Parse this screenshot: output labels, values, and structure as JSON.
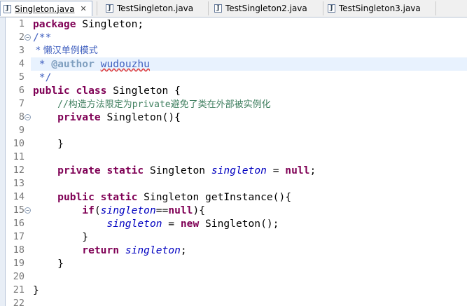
{
  "tabs": [
    {
      "label": "Singleton.java",
      "active": true,
      "close": "✕"
    },
    {
      "label": "TestSingleton.java",
      "active": false
    },
    {
      "label": "TestSingleton2.java",
      "active": false
    },
    {
      "label": "TestSingleton3.java",
      "active": false
    }
  ],
  "editor": {
    "line_numbers": [
      "1",
      "2",
      "3",
      "4",
      "5",
      "6",
      "7",
      "8",
      "9",
      "10",
      "11",
      "12",
      "13",
      "14",
      "15",
      "16",
      "17",
      "18",
      "19",
      "20",
      "21",
      "22"
    ],
    "code": {
      "l1_kw": "package",
      "l1_rest": " Singleton;",
      "l2": "/**",
      "l3": " * 懒汉单例模式",
      "l4_star": " * ",
      "l4_tag": "@author",
      "l4_sp": " ",
      "l4_name": "wudouzhu",
      "l5": " */",
      "l6_kw1": "public",
      "l6_sp": " ",
      "l6_kw2": "class",
      "l6_rest": " Singleton {",
      "l7_indent": "    ",
      "l7_comment": "//构造方法限定为private避免了类在外部被实例化",
      "l8_indent": "    ",
      "l8_kw": "private",
      "l8_rest": " Singleton(){",
      "l10": "    }",
      "l12_indent": "    ",
      "l12_kw1": "private",
      "l12_sp": " ",
      "l12_kw2": "static",
      "l12_mid": " Singleton ",
      "l12_field": "singleton",
      "l12_eq": " = ",
      "l12_null": "null",
      "l12_end": ";",
      "l14_indent": "    ",
      "l14_kw1": "public",
      "l14_sp": " ",
      "l14_kw2": "static",
      "l14_rest": " Singleton getInstance(){",
      "l15_indent": "        ",
      "l15_kw": "if",
      "l15_open": "(",
      "l15_field": "singleton",
      "l15_op": "==",
      "l15_null": "null",
      "l15_close": "){",
      "l16_indent": "            ",
      "l16_field": "singleton",
      "l16_eq": " = ",
      "l16_kw": "new",
      "l16_rest": " Singleton();",
      "l17": "        }",
      "l18_indent": "        ",
      "l18_kw": "return",
      "l18_sp": " ",
      "l18_field": "singleton",
      "l18_end": ";",
      "l19": "    }",
      "l21": "}"
    },
    "fold_markers": {
      "line2": "−",
      "line8": "−",
      "line14": "−"
    }
  }
}
